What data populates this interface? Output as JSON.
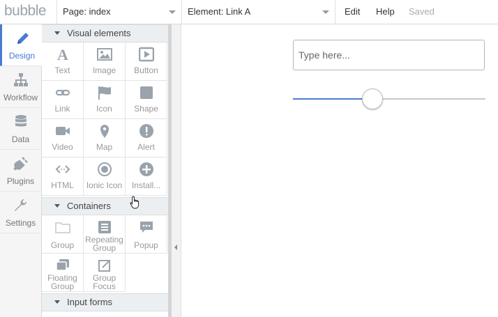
{
  "header": {
    "logo": "bubble",
    "page_selector": "Page: index",
    "element_selector": "Element: Link A",
    "menu": {
      "edit": "Edit",
      "help": "Help",
      "status": "Saved"
    }
  },
  "sidebar": {
    "items": [
      {
        "label": "Design",
        "icon": "pencil-icon",
        "active": true
      },
      {
        "label": "Workflow",
        "icon": "sitemap-icon"
      },
      {
        "label": "Data",
        "icon": "database-icon"
      },
      {
        "label": "Plugins",
        "icon": "plug-icon"
      },
      {
        "label": "Settings",
        "icon": "wrench-icon"
      }
    ]
  },
  "palette": {
    "visual_title": "Visual elements",
    "visual": [
      {
        "label": "Text",
        "icon": "text-icon"
      },
      {
        "label": "Image",
        "icon": "image-icon"
      },
      {
        "label": "Button",
        "icon": "button-icon"
      },
      {
        "label": "Link",
        "icon": "link-icon"
      },
      {
        "label": "Icon",
        "icon": "flag-icon"
      },
      {
        "label": "Shape",
        "icon": "shape-icon"
      },
      {
        "label": "Video",
        "icon": "video-icon"
      },
      {
        "label": "Map",
        "icon": "map-marker-icon"
      },
      {
        "label": "Alert",
        "icon": "alert-icon"
      },
      {
        "label": "HTML",
        "icon": "code-icon"
      },
      {
        "label": "Ionic Icon",
        "icon": "ionic-icon"
      },
      {
        "label": "Install...",
        "icon": "plus-circle-icon"
      }
    ],
    "containers_title": "Containers",
    "containers": [
      {
        "label1": "Group",
        "label2": "",
        "icon": "folder-icon"
      },
      {
        "label1": "Repeating",
        "label2": "Group",
        "icon": "list-icon"
      },
      {
        "label1": "Popup",
        "label2": "",
        "icon": "popup-icon"
      },
      {
        "label1": "Floating",
        "label2": "Group",
        "icon": "floating-icon"
      },
      {
        "label1": "Group",
        "label2": "Focus",
        "icon": "focus-icon"
      }
    ],
    "input_title": "Input forms"
  },
  "canvas": {
    "input_placeholder": "Type here...",
    "slider_value": 0.41
  },
  "colors": {
    "accent": "#4a7bd0",
    "icon": "#9aa3ab"
  }
}
